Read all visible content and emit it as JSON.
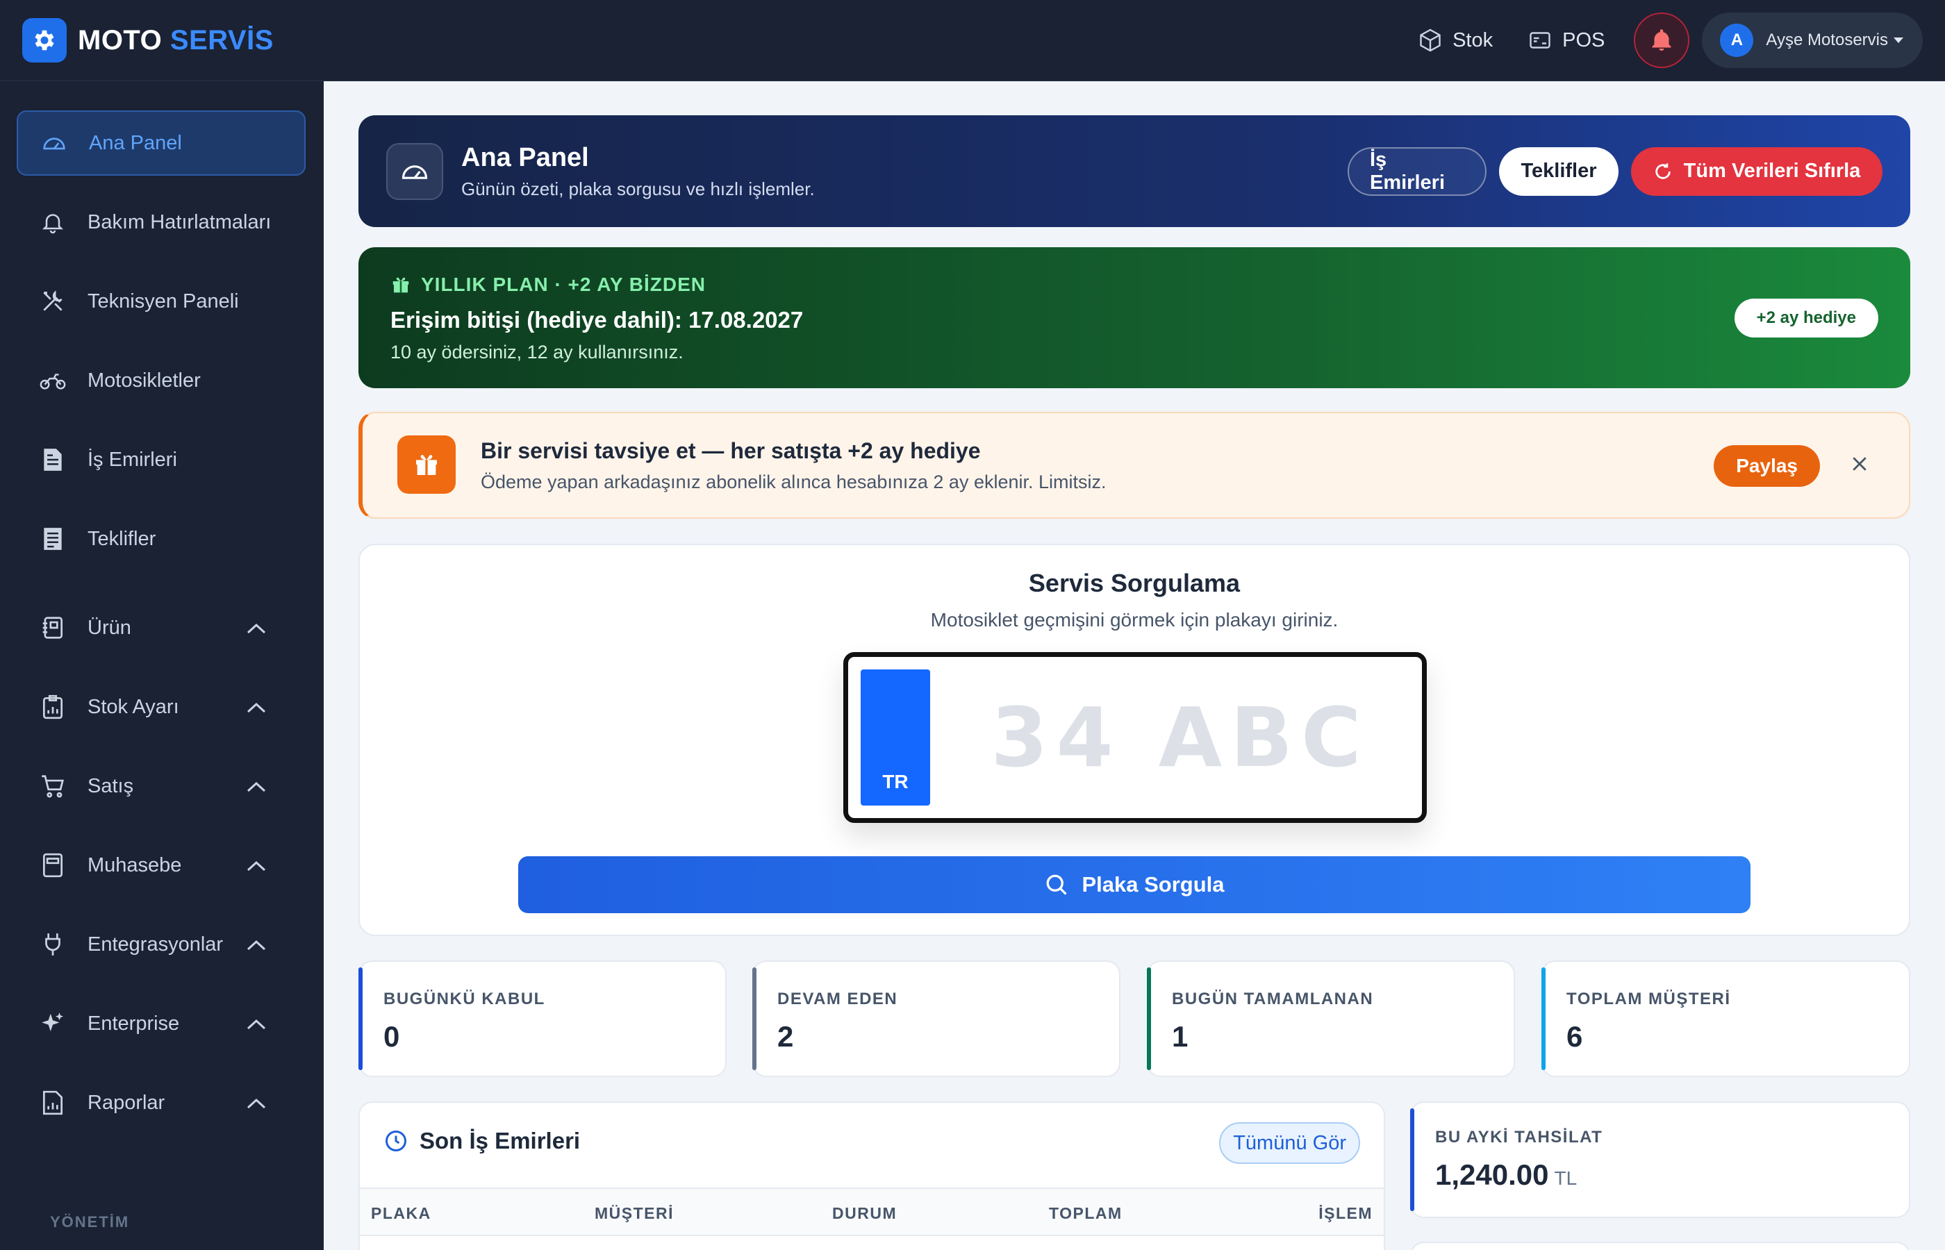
{
  "brand": {
    "name": "MOTO",
    "accent": "SERVİS"
  },
  "topbar": {
    "stock_label": "Stok",
    "pos_label": "POS",
    "user": {
      "initial": "A",
      "name": "Ayşe Motoservis"
    }
  },
  "sidebar": {
    "items": [
      {
        "label": "Ana Panel"
      },
      {
        "label": "Bakım Hatırlatmaları"
      },
      {
        "label": "Teknisyen Paneli"
      },
      {
        "label": "Motosikletler"
      },
      {
        "label": "İş Emirleri"
      },
      {
        "label": "Teklifler"
      },
      {
        "label": "Ürün"
      },
      {
        "label": "Stok Ayarı"
      },
      {
        "label": "Satış"
      },
      {
        "label": "Muhasebe"
      },
      {
        "label": "Entegrasyonlar"
      },
      {
        "label": "Enterprise"
      },
      {
        "label": "Raporlar"
      }
    ],
    "section": "YÖNETİM"
  },
  "hero": {
    "title": "Ana Panel",
    "subtitle": "Günün özeti, plaka sorgusu ve hızlı işlemler.",
    "btn_orders": "İş Emirleri",
    "btn_quotes": "Teklifler",
    "btn_reset": "Tüm Verileri Sıfırla"
  },
  "plan": {
    "eyebrow": "YILLIK PLAN · +2 AY BİZDEN",
    "title": "Erişim bitişi (hediye dahil): 17.08.2027",
    "subtitle": "10 ay ödersiniz, 12 ay kullanırsınız.",
    "badge": "+2 ay hediye"
  },
  "referral": {
    "title": "Bir servisi tavsiye et — her satışta +2 ay hediye",
    "subtitle": "Ödeme yapan arkadaşınız abonelik alınca hesabınıza 2 ay eklenir. Limitsiz.",
    "share_label": "Paylaş"
  },
  "search": {
    "title": "Servis Sorgulama",
    "subtitle": "Motosiklet geçmişini görmek için plakayı giriniz.",
    "country": "TR",
    "placeholder": "34 ABC",
    "button": "Plaka Sorgula"
  },
  "stats": [
    {
      "label": "BUGÜNKÜ KABUL",
      "value": "0",
      "color": "#1d4ed8"
    },
    {
      "label": "DEVAM EDEN",
      "value": "2",
      "color": "#64748b"
    },
    {
      "label": "BUGÜN TAMAMLANAN",
      "value": "1",
      "color": "#047857"
    },
    {
      "label": "TOPLAM MÜŞTERİ",
      "value": "6",
      "color": "#0ea5e9"
    }
  ],
  "jobs": {
    "title": "Son İş Emirleri",
    "view_all": "Tümünü Gör",
    "columns": [
      "PLAKA",
      "MÜŞTERİ",
      "DURUM",
      "TOPLAM",
      "İŞLEM"
    ]
  },
  "collection": {
    "label": "BU AYKİ TAHSİLAT",
    "value": "1,240.00",
    "currency": "TL"
  }
}
